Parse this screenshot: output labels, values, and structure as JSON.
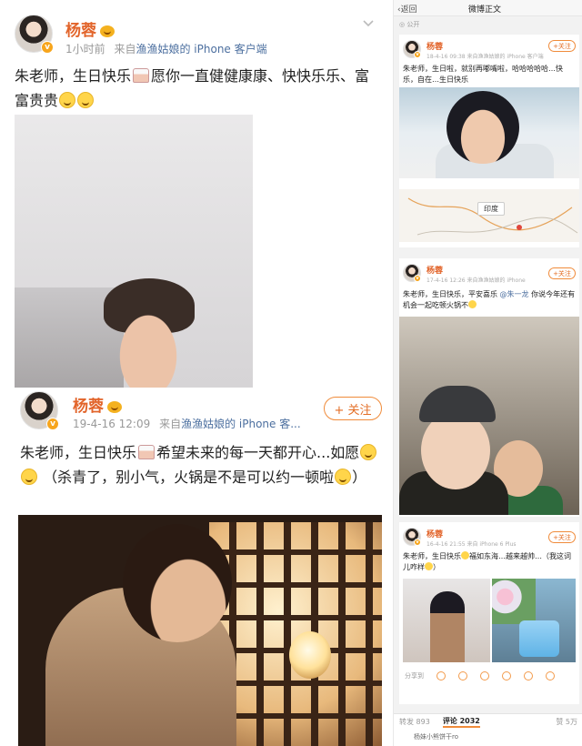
{
  "post1": {
    "author": "杨蓉",
    "time": "1小时前",
    "source_prefix": "来自",
    "source": "渔渔姑娘的 iPhone 客户端",
    "text": "朱老师，生日快乐",
    "text_after_cake": "愿你一直健健康康、快快乐乐、富富贵贵"
  },
  "post2": {
    "author": "杨蓉",
    "date": "19-4-16 12:09",
    "source_prefix": "来自",
    "source": "渔渔姑娘的 iPhone 客...",
    "follow_label": "+ 关注",
    "text_a": "朱老师，生日快乐",
    "text_b": "希望未来的每一天都开心...如愿",
    "text_c": "（杀青了，别小气，火锅是不是可以约一顿啦",
    "text_d": "）"
  },
  "right": {
    "topbar": {
      "back": "‹返回",
      "title": "微博正文",
      "visibility": "公开"
    },
    "card1": {
      "name": "杨蓉",
      "meta": "18-4-16 09:38  来自渔渔姑娘的 iPhone 客户端",
      "follow": "+关注",
      "text": "朱老师，生日啦，就别再嘟嘴啦，哈哈哈哈哈…快乐，自在…生日快乐",
      "map_label": "印度"
    },
    "card2": {
      "name": "杨蓉",
      "meta": "17-4-16 12:26  来自渔渔姑娘的 iPhone",
      "follow": "+关注",
      "text": "朱老师，生日快乐，平安喜乐",
      "mention": "@朱一龙",
      "text2": "你说今年还有机会一起吃顿火锅不"
    },
    "card3": {
      "name": "杨蓉",
      "meta": "16-4-16 21:55  来自 iPhone 6 Plus",
      "follow": "+关注",
      "text": "朱老师，生日快乐",
      "text2": "福如东海…越来越帅…（我这词儿咋样",
      "text3": "）",
      "share_label": "分享到"
    },
    "tabs": {
      "repost": "转发 893",
      "comment": "评论 2032",
      "like": "赞 5万"
    },
    "comment_preview": "杨妹小熊饼干ro"
  }
}
